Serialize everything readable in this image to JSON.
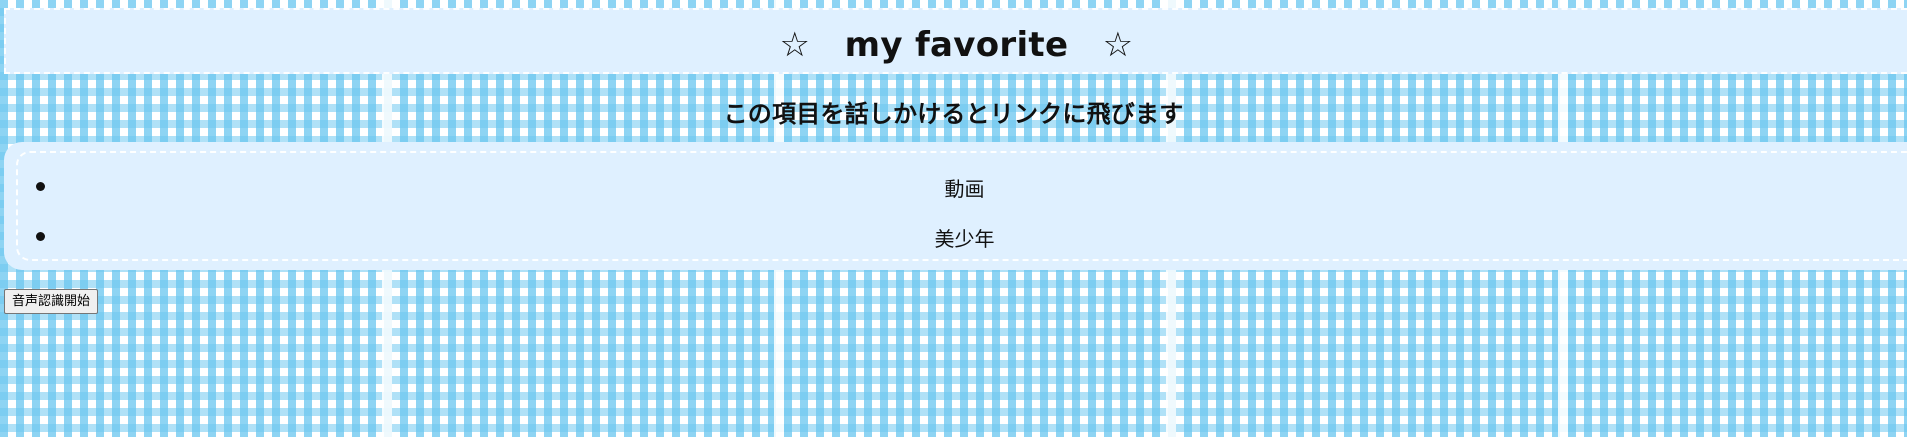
{
  "header": {
    "title": "☆　my favorite　☆"
  },
  "instruction": {
    "text": "この項目を話しかけるとリンクに飛びます"
  },
  "favorites": [
    {
      "label": "動画"
    },
    {
      "label": "美少年"
    }
  ],
  "controls": {
    "speech_button_label": "音声認識開始"
  },
  "colors": {
    "check_blue": "#6ec8f0",
    "panel_bg": "#dff0ff"
  }
}
